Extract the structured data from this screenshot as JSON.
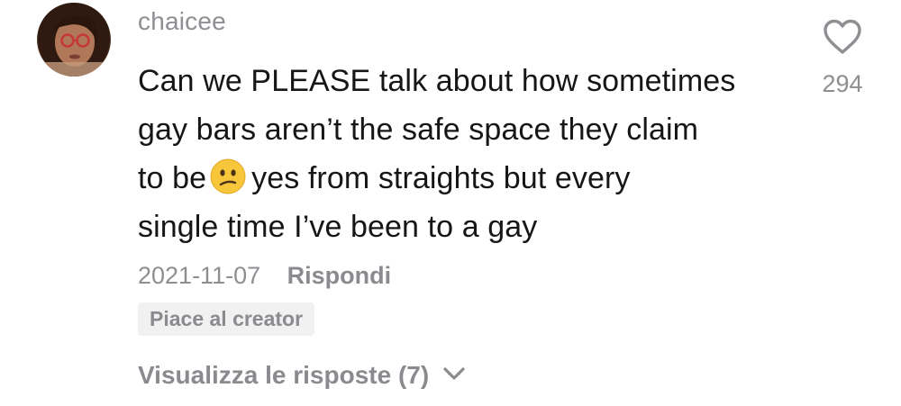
{
  "comment": {
    "username": "chaicee",
    "text_lines": [
      "Can we PLEASE talk about how sometimes",
      "gay bars aren’t the safe space they claim",
      "to be",
      "yes from straights but every",
      "single time I’ve been to a gay"
    ],
    "emoji": "confused-face",
    "date": "2021-11-07",
    "reply_label": "Rispondi",
    "creator_badge": "Piace al creator",
    "view_replies_label": "Visualizza le risposte (7)",
    "like_count": "294"
  },
  "icons": {
    "like": "heart-outline-icon",
    "expand": "chevron-down-icon",
    "emoji": "confused-face-emoji"
  },
  "colors": {
    "text_primary": "#161616",
    "text_secondary": "#8e8e93",
    "badge_bg": "#f1f1f2",
    "background": "#ffffff"
  }
}
